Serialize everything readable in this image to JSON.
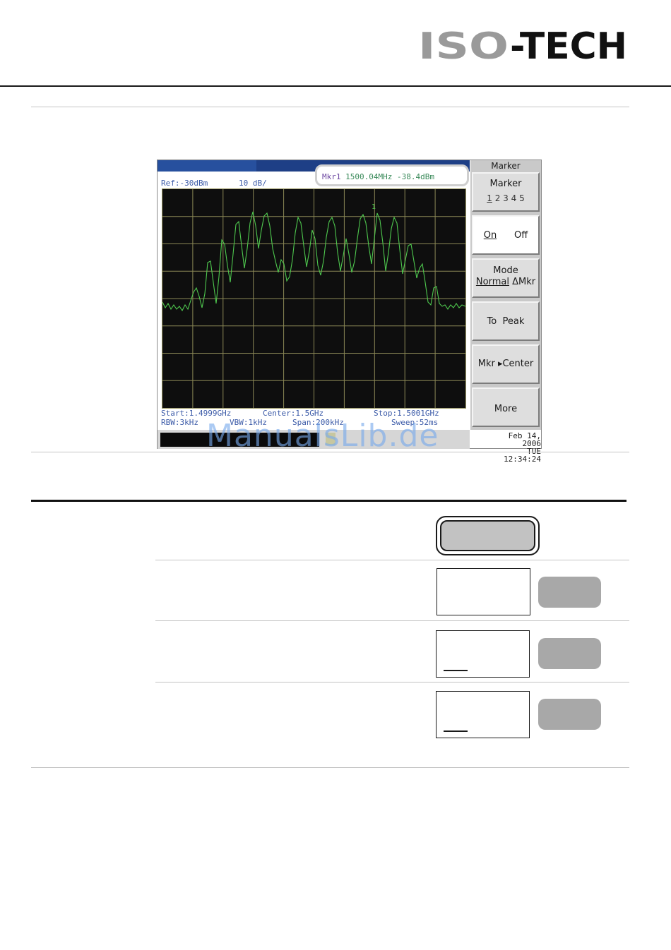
{
  "logo": {
    "text": "ISO-TECH",
    "colors": {
      "iso": "#9a9a9a",
      "tech": "#111111"
    }
  },
  "analyzer": {
    "readout": {
      "label": "Mkr1",
      "frequency": "1500.04MHz",
      "level": "-38.4dBm"
    },
    "ref": "Ref:-30dBm",
    "scale": "10 dB/",
    "marker_number": "1",
    "start": "Start:1.4999GHz",
    "center": "Center:1.5GHz",
    "stop": "Stop:1.5001GHz",
    "rbw": "RBW:3kHz",
    "vbw": "VBW:1kHz",
    "span": "Span:200kHz",
    "sweep": "Sweep:52ms",
    "date": "Feb 14, 2006",
    "time": "TUE 12:34:24",
    "softkeys": {
      "title": "Marker",
      "marker_label": "Marker",
      "marker_num_1": "1",
      "marker_nums_rest": "2 3 4 5",
      "on": "On",
      "off": "Off",
      "mode": "Mode",
      "mode_normal": "Normal",
      "mode_delta": "ΔMkr",
      "to": "To",
      "peak": "Peak",
      "mkr_center": "Mkr ▸Center",
      "more": "More"
    },
    "colors": {
      "trace": "#4ec84e",
      "grid": "#9d9a66",
      "plot_bg": "#0e0e0e",
      "label_blue": "#3c5ba8"
    }
  },
  "watermark": "ManualsLib.de"
}
